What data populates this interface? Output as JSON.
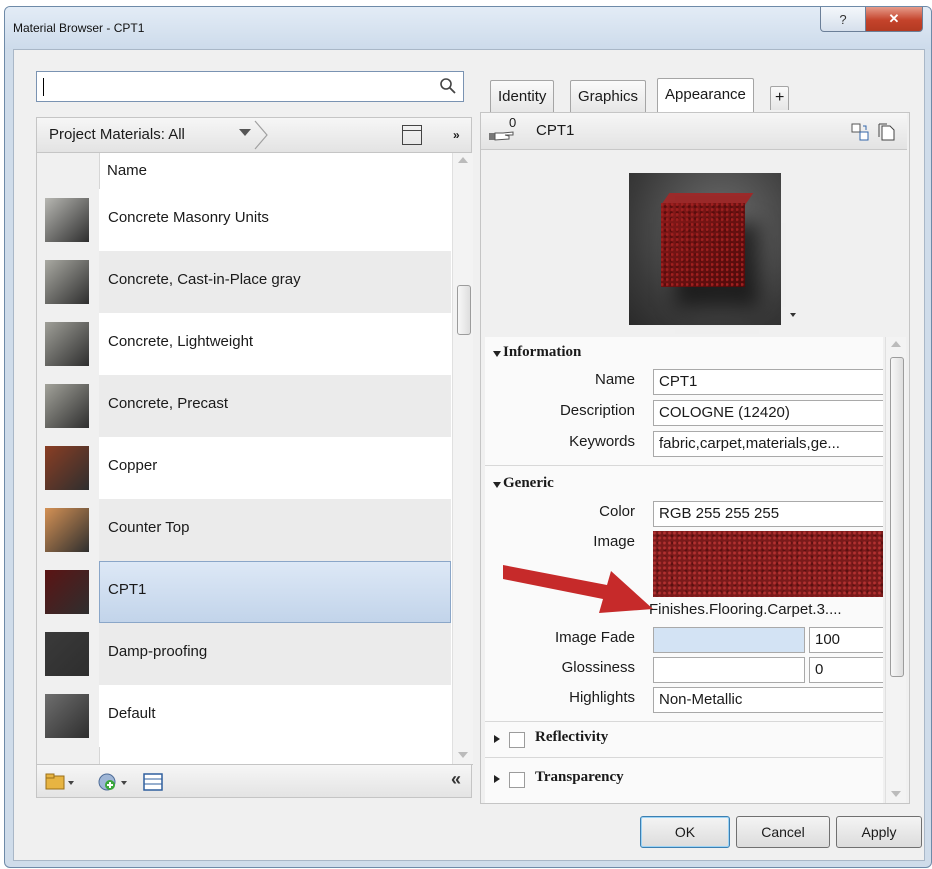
{
  "window": {
    "title": "Material Browser - CPT1",
    "help_glyph": "?",
    "close_glyph": "✕"
  },
  "left": {
    "search": {
      "value": "",
      "placeholder": ""
    },
    "library": {
      "label": "Project Materials: All",
      "overflow": "»"
    },
    "list_header": "Name",
    "items": [
      {
        "label": "Concrete Masonry Units",
        "thumb": "#b7b7b2",
        "selected": false
      },
      {
        "label": "Concrete, Cast-in-Place gray",
        "thumb": "#a9a9a2",
        "selected": false
      },
      {
        "label": "Concrete, Lightweight",
        "thumb": "#9f9f98",
        "selected": false
      },
      {
        "label": "Concrete, Precast",
        "thumb": "#a2a29a",
        "selected": false
      },
      {
        "label": "Copper",
        "thumb": "#8a3e24",
        "selected": false
      },
      {
        "label": "Counter Top",
        "thumb": "#d49155",
        "selected": false
      },
      {
        "label": "CPT1",
        "thumb": "#5b1414",
        "selected": true
      },
      {
        "label": "Damp-proofing",
        "thumb": "#3a3a3a",
        "selected": false
      },
      {
        "label": "Default",
        "thumb": "#6e6e6e",
        "selected": false
      }
    ],
    "collapse_glyph": "«"
  },
  "right": {
    "tabs": [
      {
        "label": "Identity"
      },
      {
        "label": "Graphics"
      },
      {
        "label": "Appearance"
      },
      {
        "label": "+"
      }
    ],
    "header": {
      "usage_count": "0",
      "material_name": "CPT1"
    },
    "sections": {
      "information": "Information",
      "generic": "Generic",
      "reflectivity": "Reflectivity",
      "transparency": "Transparency"
    },
    "info": {
      "name_label": "Name",
      "name_value": "CPT1",
      "desc_label": "Description",
      "desc_value": "COLOGNE (12420)",
      "kw_label": "Keywords",
      "kw_value": "fabric,carpet,materials,ge..."
    },
    "generic": {
      "color_label": "Color",
      "color_value": "RGB 255 255 255",
      "image_label": "Image",
      "image_file": "Finishes.Flooring.Carpet.3....",
      "fade_label": "Image Fade",
      "fade_value": "100",
      "gloss_label": "Glossiness",
      "gloss_value": "0",
      "highlights_label": "Highlights",
      "highlights_value": "Non-Metallic"
    }
  },
  "buttons": {
    "ok": "OK",
    "cancel": "Cancel",
    "apply": "Apply"
  },
  "colors": {
    "selection": "#c9d9ee",
    "arrow": "#c62a2a"
  }
}
